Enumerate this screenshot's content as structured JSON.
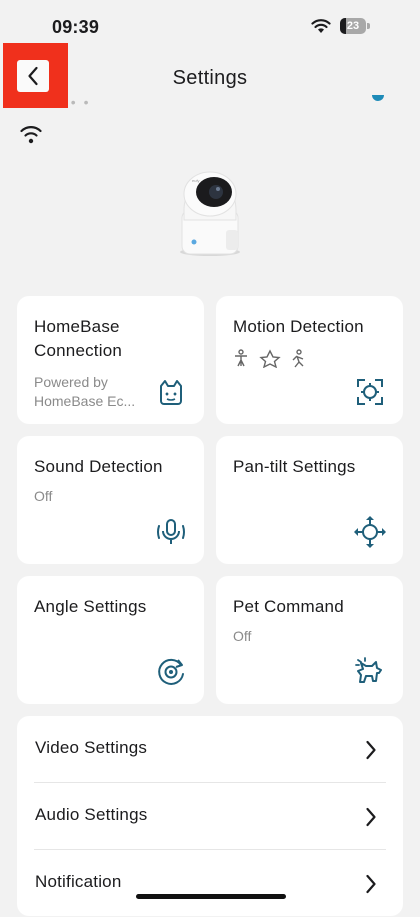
{
  "status_bar": {
    "time": "09:39",
    "battery_level": "23"
  },
  "nav": {
    "title": "Settings"
  },
  "tiles": [
    {
      "title": "HomeBase Connection",
      "subtitle": "Powered by HomeBase Ec...",
      "icon": "homebase-icon"
    },
    {
      "title": "Motion Detection",
      "subtitle": "",
      "icon": "motion-target-icon",
      "sub_icons": [
        "human-icon",
        "pet-star-icon",
        "running-person-icon"
      ]
    },
    {
      "title": "Sound Detection",
      "subtitle": "Off",
      "icon": "microphone-icon"
    },
    {
      "title": "Pan-tilt Settings",
      "subtitle": "",
      "icon": "pan-tilt-arrows-icon"
    },
    {
      "title": "Angle Settings",
      "subtitle": "",
      "icon": "angle-rotate-icon"
    },
    {
      "title": "Pet Command",
      "subtitle": "Off",
      "icon": "pet-dog-icon"
    }
  ],
  "list": [
    {
      "label": "Video Settings"
    },
    {
      "label": "Audio Settings"
    },
    {
      "label": "Notification"
    }
  ],
  "colors": {
    "accent": "#1f5f7a",
    "background": "#f2f2f2",
    "card": "#ffffff",
    "back_highlight": "#f0301c"
  }
}
